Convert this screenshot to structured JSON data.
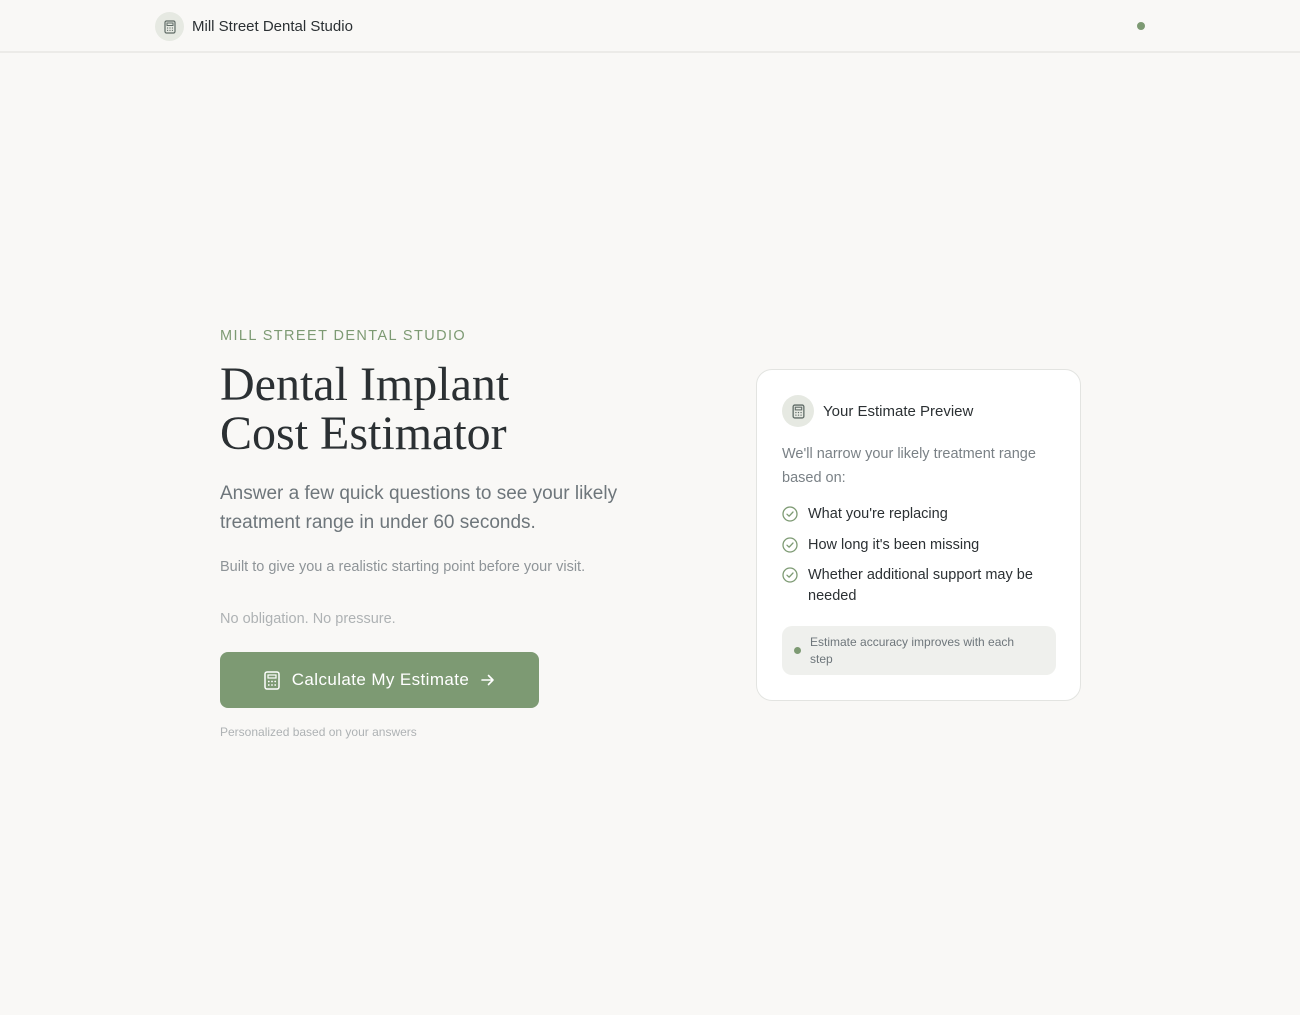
{
  "header": {
    "brand_name": "Mill Street Dental Studio",
    "logo_icon": "calculator-icon",
    "status_icon": "status-dot-icon"
  },
  "hero": {
    "eyebrow": "MILL STREET DENTAL STUDIO",
    "title_line1": "Dental Implant",
    "title_line2": "Cost Estimator",
    "lead": "Answer a few quick questions to see your likely treatment range in under 60 seconds.",
    "sub": "Built to give you a realistic starting point before your visit.",
    "reassurance": "No obligation. No pressure.",
    "cta_label": "Calculate My Estimate",
    "cta_icon": "calculator-icon",
    "cta_arrow_icon": "arrow-right-icon",
    "footnote": "Personalized based on your answers"
  },
  "preview_card": {
    "icon": "calculator-icon",
    "title": "Your Estimate Preview",
    "description": "We'll narrow your likely treatment range based on:",
    "items": [
      {
        "label": "What you're replacing",
        "icon": "check-circle-icon"
      },
      {
        "label": "How long it's been missing",
        "icon": "check-circle-icon"
      },
      {
        "label": "Whether additional support may be needed",
        "icon": "check-circle-icon"
      }
    ],
    "note": "Estimate accuracy improves with each step"
  },
  "colors": {
    "accent": "#7d9a73",
    "background": "#f9f8f6",
    "card": "#ffffff",
    "text_primary": "#2b3033",
    "text_muted": "#6e767b"
  }
}
